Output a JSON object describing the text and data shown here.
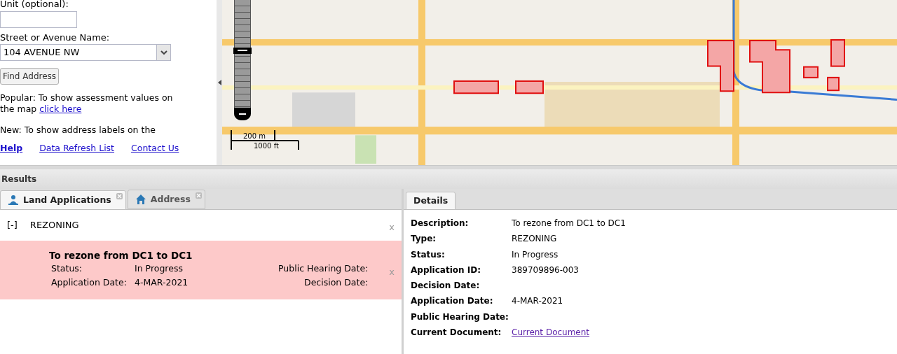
{
  "search": {
    "unit_label": "Unit (optional):",
    "street_label": "Street or Avenue Name:",
    "street_value": "104 AVENUE NW",
    "find_button": "Find Address",
    "popular_text": "Popular: To show assessment values on the map",
    "popular_link": "click here",
    "new_text": "New: To show address labels on the"
  },
  "footer_links": [
    "Help",
    "Data Refresh List",
    "Contact Us"
  ],
  "map": {
    "zoom": {
      "level": 0.55
    },
    "scale_metric": "200 m",
    "scale_imperial": "1000 ft"
  },
  "results": {
    "title": "Results",
    "tabs": [
      {
        "label": "Land Applications",
        "selected": true
      },
      {
        "label": "Address",
        "selected": false
      }
    ],
    "group": {
      "toggle": "[-]",
      "title": "REZONING",
      "close": "x"
    },
    "items": [
      {
        "title": "To rezone from DC1 to DC1",
        "selected": true,
        "close": "x",
        "fields_left": [
          {
            "label": "Status:",
            "value": "In Progress"
          },
          {
            "label": "Application Date:",
            "value": "4-MAR-2021"
          }
        ],
        "fields_right": [
          {
            "label": "Public Hearing Date:"
          },
          {
            "label": "Decision Date:"
          }
        ]
      }
    ]
  },
  "details": {
    "tab": {
      "label": "Details",
      "selected": true
    },
    "rows": [
      {
        "label": "Description:",
        "value": "To rezone from DC1 to DC1"
      },
      {
        "label": "Type:",
        "value": "REZONING"
      },
      {
        "label": "Status:",
        "value": "In Progress"
      },
      {
        "label": "Application ID:",
        "value": "389709896-003"
      },
      {
        "label": "Decision Date:"
      },
      {
        "label": "Application Date:",
        "value": "4-MAR-2021"
      },
      {
        "label": "Public Hearing Date:"
      },
      {
        "label": "Current Document:",
        "value": "Current Document",
        "kind": "link"
      }
    ]
  }
}
